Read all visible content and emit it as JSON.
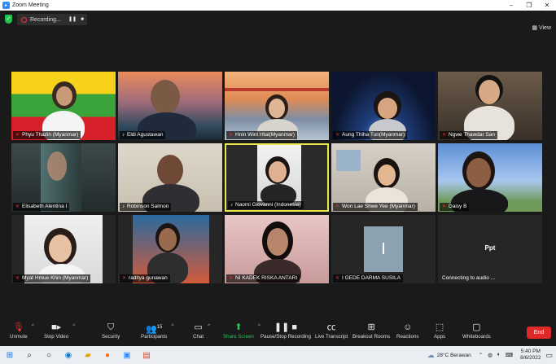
{
  "window": {
    "title": "Zoom Meeting"
  },
  "recording": {
    "label": "Recording..."
  },
  "view": {
    "label": "View"
  },
  "participants": [
    {
      "name": "Phyu Thazin (Myanmar)",
      "muted": true
    },
    {
      "name": "Eldi Agustawan",
      "muted": false
    },
    {
      "name": "Hnin Wint Htal(Myanmar)",
      "muted": true
    },
    {
      "name": "Aung Thiha Tun(Myanmar)",
      "muted": true
    },
    {
      "name": "Ngwe Thawdar San",
      "muted": true
    },
    {
      "name": "Elisabeth Alentina I",
      "muted": true
    },
    {
      "name": "Robinson Salmon",
      "muted": false
    },
    {
      "name": "Naomi Giovanni (Indonesia)",
      "muted": false
    },
    {
      "name": "Won Lae Shwe Yee (Myanmar)",
      "muted": true
    },
    {
      "name": "Daisy B",
      "muted": true
    },
    {
      "name": "Myat Hmue Khin (Myanmar)",
      "muted": true
    },
    {
      "name": "raditya gunawan",
      "muted": true
    },
    {
      "name": "NI KADEK RISKA ANTARI",
      "muted": true
    },
    {
      "name": "I GEDE DARMA SUSILA",
      "muted": true
    },
    {
      "name": "Connecting to audio ...",
      "muted": false
    }
  ],
  "tiles_extra": {
    "initial": "I",
    "ppt_label": "Ppt"
  },
  "toolbar": {
    "unmute": "Unmute",
    "stop_video": "Stop Video",
    "security": "Security",
    "participants": "Participants",
    "participants_count": "15",
    "chat": "Chat",
    "share_screen": "Share Screen",
    "pause_recording": "Pause/Stop Recording",
    "live_transcript": "Live Transcript",
    "breakout_rooms": "Breakout Rooms",
    "reactions": "Reactions",
    "apps": "Apps",
    "whiteboards": "Whiteboards",
    "end": "End"
  },
  "taskbar": {
    "weather": "28°C Berawan",
    "time": "5:40 PM",
    "date": "8/6/2022"
  },
  "colors": {
    "active_speaker": "#e8e84a",
    "share_green": "#23c552",
    "end_red": "#e02828"
  }
}
